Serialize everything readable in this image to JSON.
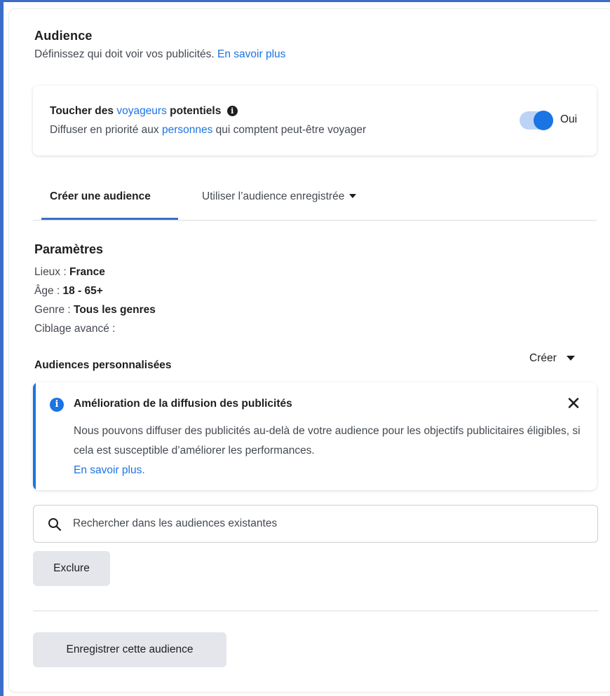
{
  "header": {
    "title": "Audience",
    "subtitle": "Définissez qui doit voir vos publicités.",
    "learn_more": "En savoir plus"
  },
  "travel": {
    "title_prefix": "Toucher des",
    "title_link": "voyageurs",
    "title_suffix": "potentiels",
    "info_icon": "info-circle-icon",
    "desc_prefix": "Diffuser en priorité aux",
    "desc_link": "personnes",
    "desc_suffix": "qui comptent peut-être voyager",
    "toggle_on": true,
    "toggle_label": "Oui"
  },
  "tabs": {
    "create": "Créer une audience",
    "saved": "Utiliser l’audience enregistrée"
  },
  "params": {
    "title": "Paramètres",
    "location_label": "Lieux :",
    "location_value": "France",
    "age_label": "Âge :",
    "age_value": "18 - 65+",
    "gender_label": "Genre :",
    "gender_value": "Tous les genres",
    "advanced_label": "Ciblage avancé :"
  },
  "custom": {
    "title": "Audiences personnalisées",
    "create_label": "Créer"
  },
  "notice": {
    "title": "Amélioration de la diffusion des publicités",
    "body": "Nous pouvons diffuser des publicités au-delà de votre audience pour les objectifs publicitaires éligibles, si cela est susceptible d’améliorer les performances.",
    "link": "En savoir plus."
  },
  "search": {
    "placeholder": "Rechercher dans les audiences existantes"
  },
  "buttons": {
    "exclude": "Exclure",
    "save": "Enregistrer cette audience"
  },
  "colors": {
    "accent": "#1b74e4",
    "tab_indicator": "#3b6ec9",
    "button_gray": "#e4e6eb"
  }
}
